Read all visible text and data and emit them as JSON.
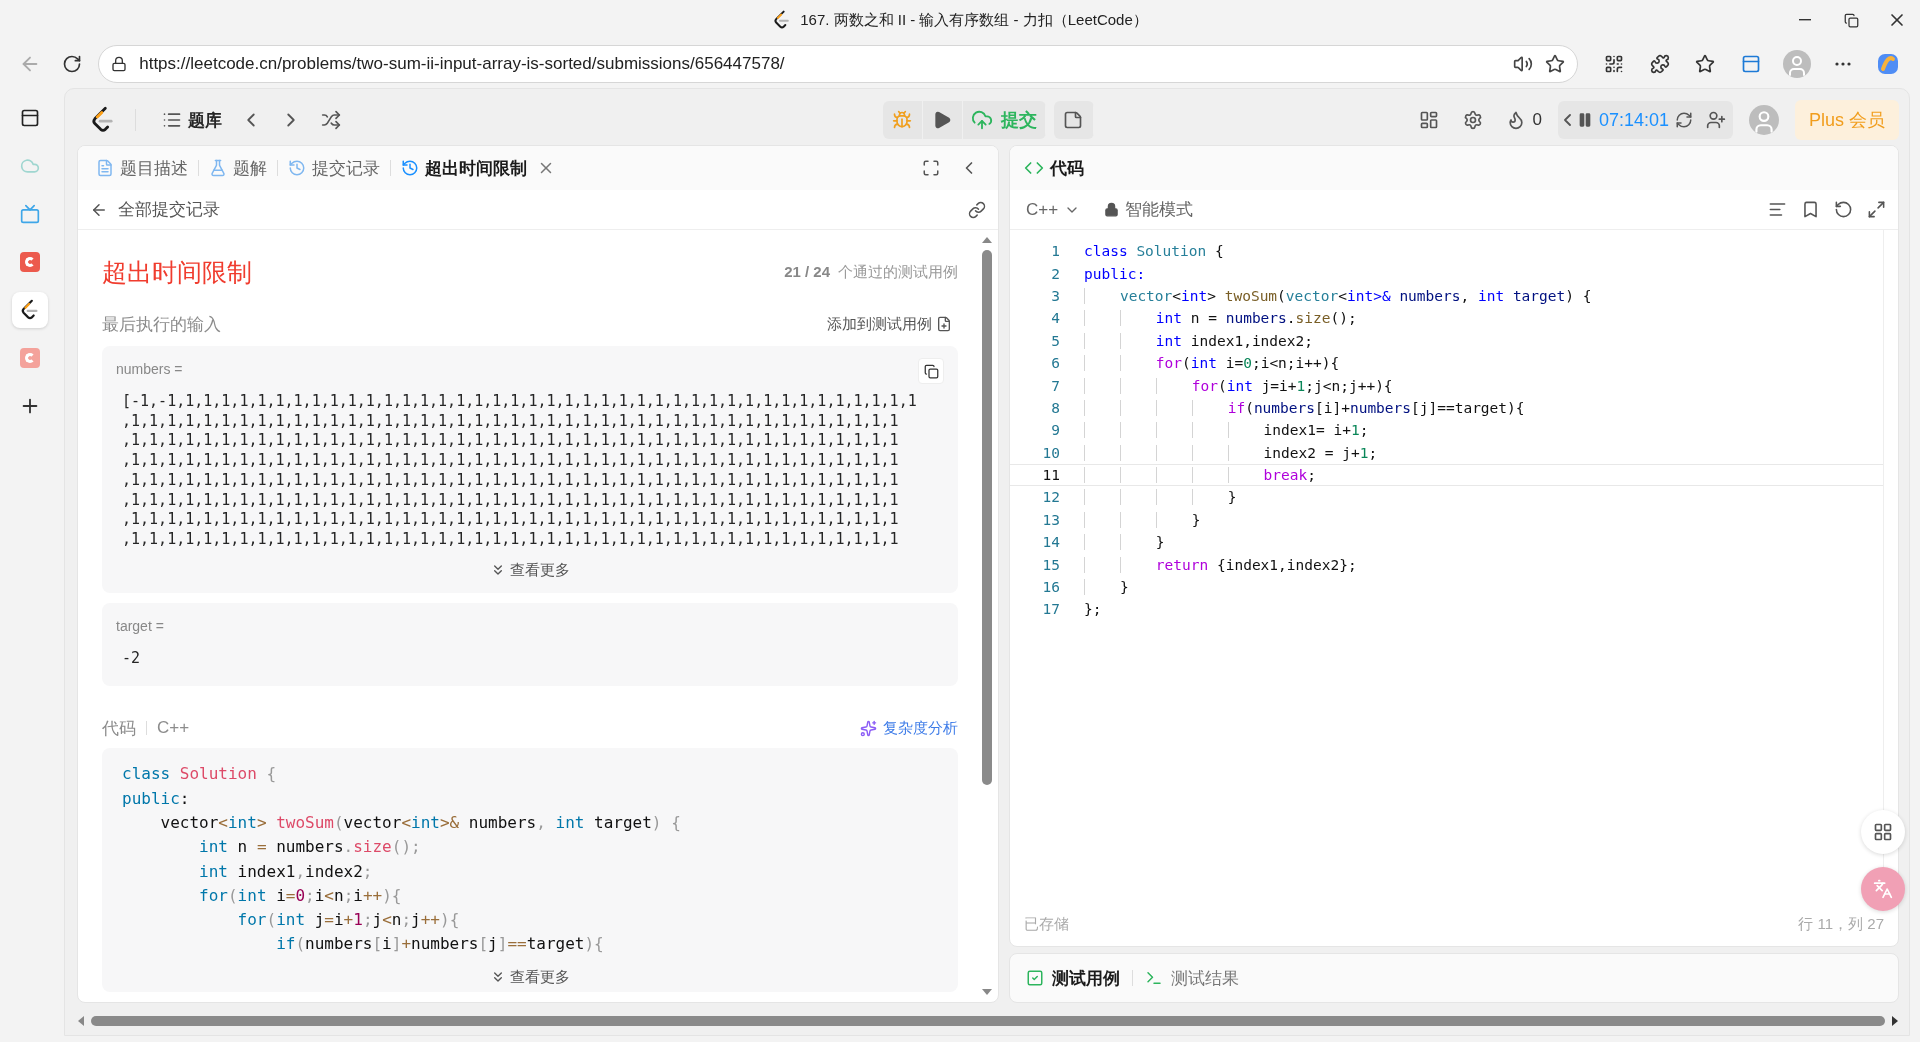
{
  "browser": {
    "title": "167. 两数之和 II - 输入有序数组 - 力扣（LeetCode）",
    "url": "https://leetcode.cn/problems/two-sum-ii-input-array-is-sorted/submissions/656447578/"
  },
  "toolbar": {
    "problem_list": "题库",
    "submit": "提交",
    "streak": "0",
    "timer": "07:14:01",
    "plus": "Plus 会员"
  },
  "left_tabs": [
    {
      "label": "题目描述",
      "kind": "description",
      "selected": false
    },
    {
      "label": "题解",
      "kind": "solutions",
      "selected": false
    },
    {
      "label": "提交记录",
      "kind": "submissions",
      "selected": false
    },
    {
      "label": "超出时间限制",
      "kind": "result",
      "selected": true
    }
  ],
  "back_link": "全部提交记录",
  "result": {
    "status": "超出时间限制",
    "passed": "21 / 24",
    "passed_label": "个通过的测试用例"
  },
  "last_input": {
    "heading": "最后执行的输入",
    "add_button": "添加到测试用例",
    "params": [
      {
        "name": "numbers =",
        "lines": [
          "[-1,-1,1,1,1,1,1,1,1,1,1,1,1,1,1,1,1,1,1,1,1,1,1,1,1,1,1,1,1,1,1,1,1,1,1,1,1,1,1,1,1,1,1",
          ",1,1,1,1,1,1,1,1,1,1,1,1,1,1,1,1,1,1,1,1,1,1,1,1,1,1,1,1,1,1,1,1,1,1,1,1,1,1,1,1,1,1,1",
          ",1,1,1,1,1,1,1,1,1,1,1,1,1,1,1,1,1,1,1,1,1,1,1,1,1,1,1,1,1,1,1,1,1,1,1,1,1,1,1,1,1,1,1",
          ",1,1,1,1,1,1,1,1,1,1,1,1,1,1,1,1,1,1,1,1,1,1,1,1,1,1,1,1,1,1,1,1,1,1,1,1,1,1,1,1,1,1,1",
          ",1,1,1,1,1,1,1,1,1,1,1,1,1,1,1,1,1,1,1,1,1,1,1,1,1,1,1,1,1,1,1,1,1,1,1,1,1,1,1,1,1,1,1",
          ",1,1,1,1,1,1,1,1,1,1,1,1,1,1,1,1,1,1,1,1,1,1,1,1,1,1,1,1,1,1,1,1,1,1,1,1,1,1,1,1,1,1,1",
          ",1,1,1,1,1,1,1,1,1,1,1,1,1,1,1,1,1,1,1,1,1,1,1,1,1,1,1,1,1,1,1,1,1,1,1,1,1,1,1,1,1,1,1",
          ",1,1,1,1,1,1,1,1,1,1,1,1,1,1,1,1,1,1,1,1,1,1,1,1,1,1,1,1,1,1,1,1,1,1,1,1,1,1,1,1,1,1,1"
        ],
        "more": "查看更多"
      },
      {
        "name": "target =",
        "lines": [
          "-2"
        ]
      }
    ]
  },
  "code_section": {
    "label": "代码",
    "language": "C++",
    "analysis": "复杂度分析",
    "more": "查看更多",
    "lines": [
      [
        {
          "text": "class",
          "kind": "keyword"
        },
        {
          "text": " Solution",
          "kind": "function"
        },
        {
          "text": " {",
          "kind": "punct"
        }
      ],
      [
        {
          "text": "public",
          "kind": "keyword"
        },
        {
          "text": ":",
          "kind": "plain"
        }
      ],
      [
        {
          "text": "    vector",
          "kind": "plain"
        },
        {
          "text": "<",
          "kind": "operator"
        },
        {
          "text": "int",
          "kind": "keyword"
        },
        {
          "text": "> ",
          "kind": "operator"
        },
        {
          "text": "twoSum",
          "kind": "function"
        },
        {
          "text": "(",
          "kind": "punct"
        },
        {
          "text": "vector",
          "kind": "plain"
        },
        {
          "text": "<",
          "kind": "operator"
        },
        {
          "text": "int",
          "kind": "keyword"
        },
        {
          "text": ">&",
          "kind": "operator"
        },
        {
          "text": " numbers",
          "kind": "plain"
        },
        {
          "text": ",",
          "kind": "punct"
        },
        {
          "text": " int",
          "kind": "keyword"
        },
        {
          "text": " target",
          "kind": "plain"
        },
        {
          "text": ")",
          "kind": "punct"
        },
        {
          "text": " {",
          "kind": "punct"
        }
      ],
      [
        {
          "text": "        int",
          "kind": "keyword"
        },
        {
          "text": " n ",
          "kind": "plain"
        },
        {
          "text": "=",
          "kind": "operator"
        },
        {
          "text": " numbers",
          "kind": "plain"
        },
        {
          "text": ".",
          "kind": "punct"
        },
        {
          "text": "size",
          "kind": "function"
        },
        {
          "text": "();",
          "kind": "punct"
        }
      ],
      [
        {
          "text": "        int",
          "kind": "keyword"
        },
        {
          "text": " index1",
          "kind": "plain"
        },
        {
          "text": ",",
          "kind": "punct"
        },
        {
          "text": "index2",
          "kind": "plain"
        },
        {
          "text": ";",
          "kind": "punct"
        }
      ],
      [
        {
          "text": "        for",
          "kind": "keyword"
        },
        {
          "text": "(",
          "kind": "punct"
        },
        {
          "text": "int",
          "kind": "keyword"
        },
        {
          "text": " i",
          "kind": "plain"
        },
        {
          "text": "=",
          "kind": "operator"
        },
        {
          "text": "0",
          "kind": "number"
        },
        {
          "text": ";",
          "kind": "punct"
        },
        {
          "text": "i",
          "kind": "plain"
        },
        {
          "text": "<",
          "kind": "operator"
        },
        {
          "text": "n",
          "kind": "plain"
        },
        {
          "text": ";",
          "kind": "punct"
        },
        {
          "text": "i",
          "kind": "plain"
        },
        {
          "text": "++",
          "kind": "operator"
        },
        {
          "text": ")",
          "kind": "punct"
        },
        {
          "text": "{",
          "kind": "punct"
        }
      ],
      [
        {
          "text": "            for",
          "kind": "keyword"
        },
        {
          "text": "(",
          "kind": "punct"
        },
        {
          "text": "int",
          "kind": "keyword"
        },
        {
          "text": " j",
          "kind": "plain"
        },
        {
          "text": "=",
          "kind": "operator"
        },
        {
          "text": "i",
          "kind": "plain"
        },
        {
          "text": "+",
          "kind": "operator"
        },
        {
          "text": "1",
          "kind": "number"
        },
        {
          "text": ";",
          "kind": "punct"
        },
        {
          "text": "j",
          "kind": "plain"
        },
        {
          "text": "<",
          "kind": "operator"
        },
        {
          "text": "n",
          "kind": "plain"
        },
        {
          "text": ";",
          "kind": "punct"
        },
        {
          "text": "j",
          "kind": "plain"
        },
        {
          "text": "++",
          "kind": "operator"
        },
        {
          "text": ")",
          "kind": "punct"
        },
        {
          "text": "{",
          "kind": "punct"
        }
      ],
      [
        {
          "text": "                if",
          "kind": "keyword"
        },
        {
          "text": "(",
          "kind": "punct"
        },
        {
          "text": "numbers",
          "kind": "plain"
        },
        {
          "text": "[",
          "kind": "punct"
        },
        {
          "text": "i",
          "kind": "plain"
        },
        {
          "text": "]",
          "kind": "punct"
        },
        {
          "text": "+",
          "kind": "operator"
        },
        {
          "text": "numbers",
          "kind": "plain"
        },
        {
          "text": "[",
          "kind": "punct"
        },
        {
          "text": "j",
          "kind": "plain"
        },
        {
          "text": "]",
          "kind": "punct"
        },
        {
          "text": "==",
          "kind": "operator"
        },
        {
          "text": "target",
          "kind": "plain"
        },
        {
          "text": ")",
          "kind": "punct"
        },
        {
          "text": "{",
          "kind": "punct"
        }
      ]
    ]
  },
  "editor": {
    "title": "代码",
    "language": "C++",
    "mode": "智能模式",
    "saved": "已存储",
    "cursor": "行 11，列 27",
    "lines": [
      {
        "n": "1",
        "current": false,
        "tokens": [
          {
            "text": "class",
            "kind": "keyword"
          },
          {
            "text": " Solution",
            "kind": "type"
          },
          {
            "text": " {",
            "kind": "plain"
          }
        ]
      },
      {
        "n": "2",
        "current": false,
        "tokens": [
          {
            "text": "public:",
            "kind": "keyword"
          }
        ]
      },
      {
        "n": "3",
        "current": false,
        "tokens": [
          {
            "text": "    vector",
            "kind": "type"
          },
          {
            "text": "<",
            "kind": "plain"
          },
          {
            "text": "int",
            "kind": "keyword"
          },
          {
            "text": "> ",
            "kind": "plain"
          },
          {
            "text": "twoSum",
            "kind": "function"
          },
          {
            "text": "(",
            "kind": "plain"
          },
          {
            "text": "vector",
            "kind": "type"
          },
          {
            "text": "<",
            "kind": "plain"
          },
          {
            "text": "int",
            "kind": "keyword"
          },
          {
            "text": ">& ",
            "kind": "keyword"
          },
          {
            "text": "numbers",
            "kind": "variable"
          },
          {
            "text": ", ",
            "kind": "plain"
          },
          {
            "text": "int",
            "kind": "keyword"
          },
          {
            "text": " target",
            "kind": "variable"
          },
          {
            "text": ") {",
            "kind": "plain"
          }
        ]
      },
      {
        "n": "4",
        "current": false,
        "tokens": [
          {
            "text": "        int",
            "kind": "keyword"
          },
          {
            "text": " n = ",
            "kind": "plain"
          },
          {
            "text": "numbers",
            "kind": "variable"
          },
          {
            "text": ".",
            "kind": "plain"
          },
          {
            "text": "size",
            "kind": "function"
          },
          {
            "text": "();",
            "kind": "plain"
          }
        ]
      },
      {
        "n": "5",
        "current": false,
        "tokens": [
          {
            "text": "        int",
            "kind": "keyword"
          },
          {
            "text": " index1,index2;",
            "kind": "plain"
          }
        ]
      },
      {
        "n": "6",
        "current": false,
        "tokens": [
          {
            "text": "        for",
            "kind": "control"
          },
          {
            "text": "(",
            "kind": "plain"
          },
          {
            "text": "int",
            "kind": "keyword"
          },
          {
            "text": " i=",
            "kind": "plain"
          },
          {
            "text": "0",
            "kind": "number"
          },
          {
            "text": ";i<n;i++){",
            "kind": "plain"
          }
        ]
      },
      {
        "n": "7",
        "current": false,
        "tokens": [
          {
            "text": "            for",
            "kind": "control"
          },
          {
            "text": "(",
            "kind": "plain"
          },
          {
            "text": "int",
            "kind": "keyword"
          },
          {
            "text": " j=i+",
            "kind": "plain"
          },
          {
            "text": "1",
            "kind": "number"
          },
          {
            "text": ";j<n;j++){",
            "kind": "plain"
          }
        ]
      },
      {
        "n": "8",
        "current": false,
        "tokens": [
          {
            "text": "                if",
            "kind": "control"
          },
          {
            "text": "(",
            "kind": "plain"
          },
          {
            "text": "numbers",
            "kind": "variable"
          },
          {
            "text": "[i]+",
            "kind": "plain"
          },
          {
            "text": "numbers",
            "kind": "variable"
          },
          {
            "text": "[j]==target){",
            "kind": "plain"
          }
        ]
      },
      {
        "n": "9",
        "current": false,
        "tokens": [
          {
            "text": "                    index1= i+",
            "kind": "plain"
          },
          {
            "text": "1",
            "kind": "number"
          },
          {
            "text": ";",
            "kind": "plain"
          }
        ]
      },
      {
        "n": "10",
        "current": false,
        "tokens": [
          {
            "text": "                    index2 = j+",
            "kind": "plain"
          },
          {
            "text": "1",
            "kind": "number"
          },
          {
            "text": ";",
            "kind": "plain"
          }
        ]
      },
      {
        "n": "11",
        "current": true,
        "tokens": [
          {
            "text": "                    break",
            "kind": "control"
          },
          {
            "text": ";",
            "kind": "plain"
          }
        ]
      },
      {
        "n": "12",
        "current": false,
        "tokens": [
          {
            "text": "                }",
            "kind": "plain"
          }
        ]
      },
      {
        "n": "13",
        "current": false,
        "tokens": [
          {
            "text": "            }",
            "kind": "plain"
          }
        ]
      },
      {
        "n": "14",
        "current": false,
        "tokens": [
          {
            "text": "        }",
            "kind": "plain"
          }
        ]
      },
      {
        "n": "15",
        "current": false,
        "tokens": [
          {
            "text": "        return",
            "kind": "control"
          },
          {
            "text": " {index1,index2};",
            "kind": "plain"
          }
        ]
      },
      {
        "n": "16",
        "current": false,
        "tokens": [
          {
            "text": "    }",
            "kind": "plain"
          }
        ]
      },
      {
        "n": "17",
        "current": false,
        "tokens": [
          {
            "text": "};",
            "kind": "plain"
          }
        ]
      }
    ]
  },
  "bottom_tabs": [
    {
      "label": "测试用例",
      "kind": "testcase",
      "selected": true
    },
    {
      "label": "测试结果",
      "kind": "result",
      "selected": false
    }
  ]
}
